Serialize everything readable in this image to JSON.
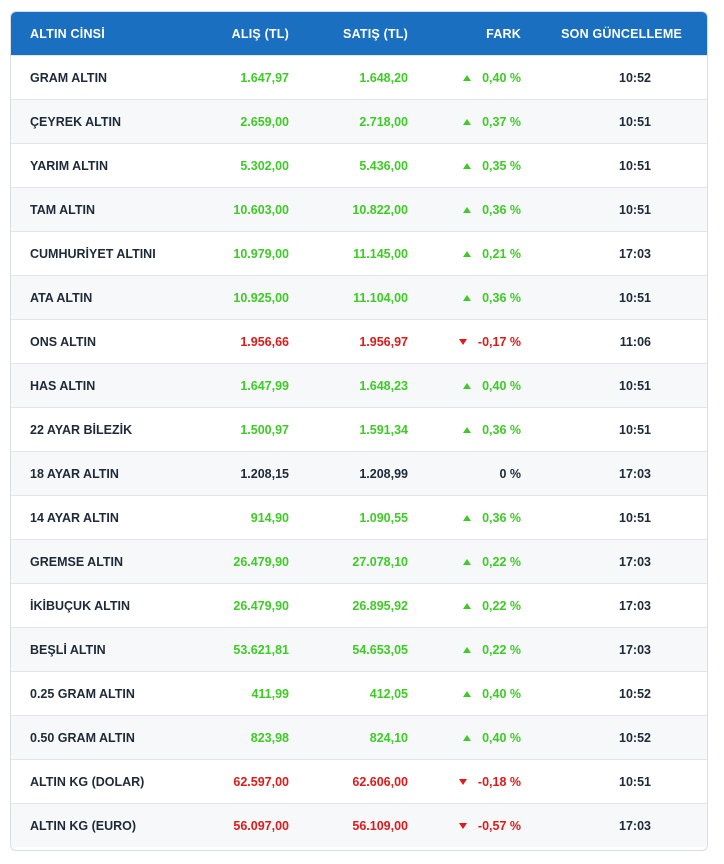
{
  "headers": {
    "name": "ALTIN CİNSİ",
    "buy": "ALIŞ (TL)",
    "sell": "SATIŞ (TL)",
    "diff": "FARK",
    "time": "SON GÜNCELLEME"
  },
  "colors": {
    "header_bg": "#1a6fc0",
    "up": "#3dcc25",
    "down": "#e01919",
    "neutral": "#1e2a38"
  },
  "rows": [
    {
      "name": "GRAM ALTIN",
      "buy": "1.647,97",
      "sell": "1.648,20",
      "diff": "0,40 %",
      "time": "10:52",
      "trend": "up"
    },
    {
      "name": "ÇEYREK ALTIN",
      "buy": "2.659,00",
      "sell": "2.718,00",
      "diff": "0,37 %",
      "time": "10:51",
      "trend": "up"
    },
    {
      "name": "YARIM ALTIN",
      "buy": "5.302,00",
      "sell": "5.436,00",
      "diff": "0,35 %",
      "time": "10:51",
      "trend": "up"
    },
    {
      "name": "TAM ALTIN",
      "buy": "10.603,00",
      "sell": "10.822,00",
      "diff": "0,36 %",
      "time": "10:51",
      "trend": "up"
    },
    {
      "name": "CUMHURİYET ALTINI",
      "buy": "10.979,00",
      "sell": "11.145,00",
      "diff": "0,21 %",
      "time": "17:03",
      "trend": "up"
    },
    {
      "name": "ATA ALTIN",
      "buy": "10.925,00",
      "sell": "11.104,00",
      "diff": "0,36 %",
      "time": "10:51",
      "trend": "up"
    },
    {
      "name": "ONS ALTIN",
      "buy": "1.956,66",
      "sell": "1.956,97",
      "diff": "-0,17 %",
      "time": "11:06",
      "trend": "down"
    },
    {
      "name": "HAS ALTIN",
      "buy": "1.647,99",
      "sell": "1.648,23",
      "diff": "0,40 %",
      "time": "10:51",
      "trend": "up"
    },
    {
      "name": "22 AYAR BİLEZİK",
      "buy": "1.500,97",
      "sell": "1.591,34",
      "diff": "0,36 %",
      "time": "10:51",
      "trend": "up"
    },
    {
      "name": "18 AYAR ALTIN",
      "buy": "1.208,15",
      "sell": "1.208,99",
      "diff": "0 %",
      "time": "17:03",
      "trend": "flat"
    },
    {
      "name": "14 AYAR ALTIN",
      "buy": "914,90",
      "sell": "1.090,55",
      "diff": "0,36 %",
      "time": "10:51",
      "trend": "up"
    },
    {
      "name": "GREMSE ALTIN",
      "buy": "26.479,90",
      "sell": "27.078,10",
      "diff": "0,22 %",
      "time": "17:03",
      "trend": "up"
    },
    {
      "name": "İKİBUÇUK ALTIN",
      "buy": "26.479,90",
      "sell": "26.895,92",
      "diff": "0,22 %",
      "time": "17:03",
      "trend": "up"
    },
    {
      "name": "BEŞLİ ALTIN",
      "buy": "53.621,81",
      "sell": "54.653,05",
      "diff": "0,22 %",
      "time": "17:03",
      "trend": "up"
    },
    {
      "name": "0.25 GRAM ALTIN",
      "buy": "411,99",
      "sell": "412,05",
      "diff": "0,40 %",
      "time": "10:52",
      "trend": "up"
    },
    {
      "name": "0.50 GRAM ALTIN",
      "buy": "823,98",
      "sell": "824,10",
      "diff": "0,40 %",
      "time": "10:52",
      "trend": "up"
    },
    {
      "name": "ALTIN KG (DOLAR)",
      "buy": "62.597,00",
      "sell": "62.606,00",
      "diff": "-0,18 %",
      "time": "10:51",
      "trend": "down"
    },
    {
      "name": "ALTIN KG (EURO)",
      "buy": "56.097,00",
      "sell": "56.109,00",
      "diff": "-0,57 %",
      "time": "17:03",
      "trend": "down"
    }
  ]
}
